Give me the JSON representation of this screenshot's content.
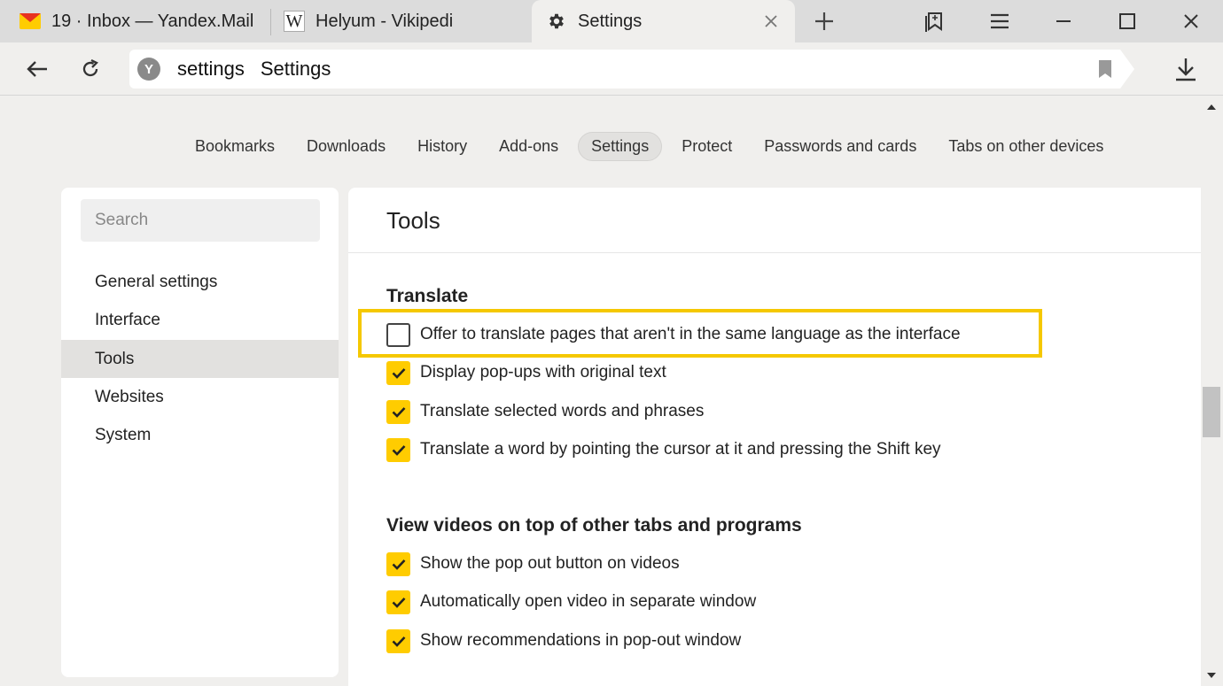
{
  "tabs": [
    {
      "label": "19 · Inbox — Yandex.Mail",
      "icon": "mail-icon"
    },
    {
      "label": "Helyum - Vikipedi",
      "icon": "wikipedia-icon"
    },
    {
      "label": "Settings",
      "icon": "gear-icon",
      "active": true
    }
  ],
  "address_bar": {
    "url": "settings",
    "title": "Settings",
    "badge": "Y"
  },
  "top_menu": [
    "Bookmarks",
    "Downloads",
    "History",
    "Add-ons",
    "Settings",
    "Protect",
    "Passwords and cards",
    "Tabs on other devices"
  ],
  "top_menu_active": "Settings",
  "sidebar": {
    "search_placeholder": "Search",
    "items": [
      "General settings",
      "Interface",
      "Tools",
      "Websites",
      "System"
    ],
    "active": "Tools"
  },
  "main": {
    "title": "Tools",
    "sections": [
      {
        "title": "Translate",
        "options": [
          {
            "label": "Offer to translate pages that aren't in the same language as the interface",
            "checked": false,
            "highlighted": true
          },
          {
            "label": "Display pop-ups with original text",
            "checked": true
          },
          {
            "label": "Translate selected words and phrases",
            "checked": true
          },
          {
            "label": "Translate a word by pointing the cursor at it and pressing the Shift key",
            "checked": true
          }
        ]
      },
      {
        "title": "View videos on top of other tabs and programs",
        "options": [
          {
            "label": "Show the pop out button on videos",
            "checked": true
          },
          {
            "label": "Automatically open video in separate window",
            "checked": true
          },
          {
            "label": "Show recommendations in pop-out window",
            "checked": true
          }
        ]
      }
    ]
  },
  "colors": {
    "accent": "#ffcc00",
    "highlight_border": "#f5c800",
    "background": "#f0efed"
  }
}
